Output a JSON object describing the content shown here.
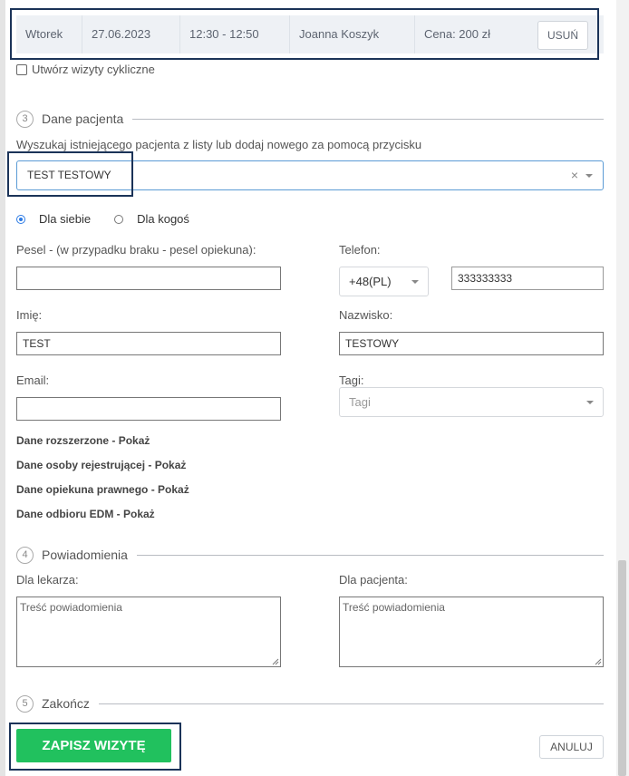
{
  "appointment": {
    "day": "Wtorek",
    "date": "27.06.2023",
    "time": "12:30 - 12:50",
    "doctor": "Joanna Koszyk",
    "price": "Cena: 200 zł",
    "remove_label": "USUŃ"
  },
  "recurring_label": "Utwórz wizyty cykliczne",
  "sections": {
    "patient": {
      "number": "3",
      "title": "Dane pacjenta"
    },
    "notifications": {
      "number": "4",
      "title": "Powiadomienia"
    },
    "finish": {
      "number": "5",
      "title": "Zakończ"
    }
  },
  "patient": {
    "hint": "Wyszukaj istniejącego pacjenta z listy lub dodaj nowego za pomocą przycisku",
    "selected": "TEST TESTOWY",
    "clear_symbol": "×",
    "radio_self": "Dla siebie",
    "radio_other": "Dla kogoś",
    "pesel_label": "Pesel - (w przypadku braku - pesel opiekuna):",
    "pesel_value": "",
    "phone_label": "Telefon:",
    "phone_prefix": "+48(PL)",
    "phone_value": "333333333",
    "first_name_label": "Imię:",
    "first_name_value": "TEST",
    "last_name_label": "Nazwisko:",
    "last_name_value": "TESTOWY",
    "email_label": "Email:",
    "email_value": "",
    "tags_label": "Tagi:",
    "tags_placeholder": "Tagi"
  },
  "links": {
    "extended": "Dane rozszerzone - Pokaż",
    "registrant": "Dane osoby rejestrującej - Pokaż",
    "guardian": "Dane opiekuna prawnego - Pokaż",
    "edm": "Dane odbioru EDM - Pokaż"
  },
  "notifications": {
    "doctor_label": "Dla lekarza:",
    "patient_label": "Dla pacjenta:",
    "placeholder": "Treść powiadomienia"
  },
  "actions": {
    "save": "ZAPISZ WIZYTĘ",
    "cancel": "ANULUJ"
  },
  "colors": {
    "highlight": "#1b3358",
    "save_green": "#21c15e",
    "focus_blue": "#5b9bd5",
    "radio_blue": "#2d7be5"
  }
}
